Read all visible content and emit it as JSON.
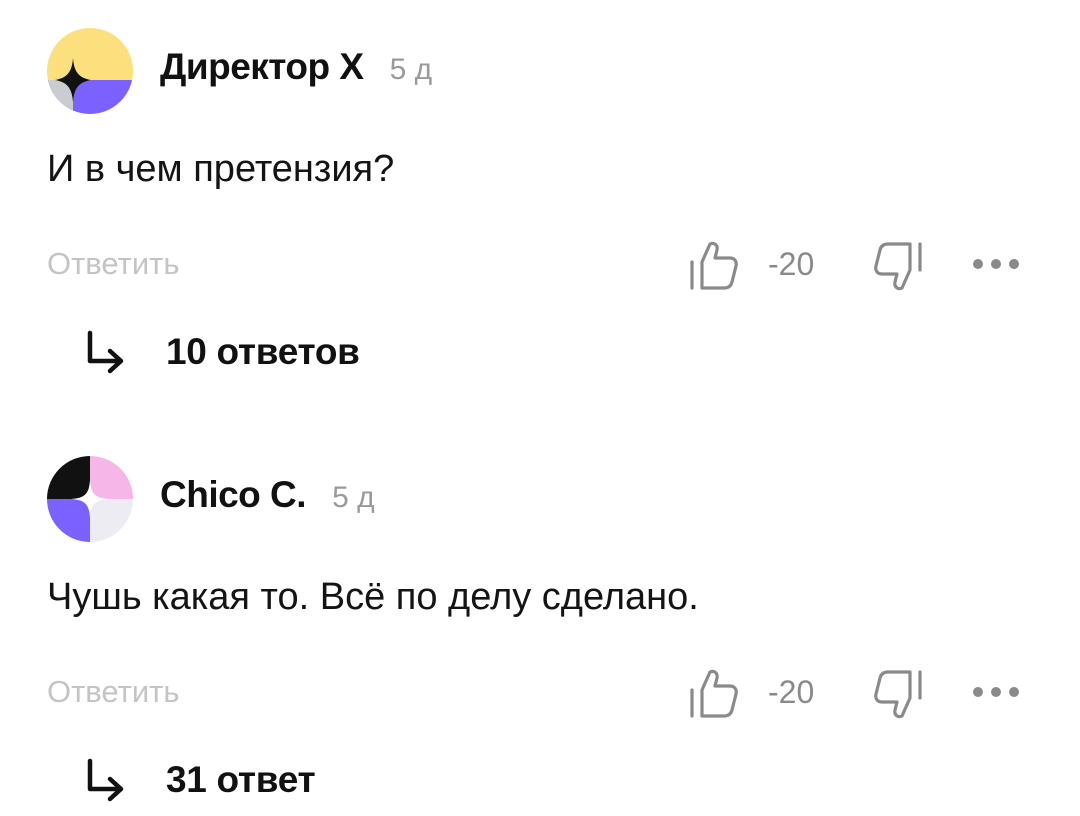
{
  "comments": [
    {
      "author": "Директор Х",
      "time": "5 д",
      "text": "И в чем претензия?",
      "reply_label": "Ответить",
      "score": "-20",
      "replies_label": "10 ответов",
      "avatar_colors": {
        "top": "#fbe07d",
        "bottom": "#7b61ff",
        "star": "#111111",
        "corner": "#c9ccd1"
      }
    },
    {
      "author": "Chico C.",
      "time": "5 д",
      "text": "Чушь какая то. Всё по делу сделано.",
      "reply_label": "Ответить",
      "score": "-20",
      "replies_label": "31 ответ",
      "avatar_colors": {
        "tl": "#111111",
        "tr": "#f7b6e8",
        "bl": "#7b61ff",
        "br": "#ececf2",
        "star": "#ffffff"
      }
    }
  ],
  "icons": {
    "like": "thumbs-up-icon",
    "dislike": "thumbs-down-icon",
    "more": "more-dots-icon",
    "replies": "reply-arrow-icon"
  },
  "colors": {
    "muted_text": "#9a9a9a",
    "reply_text": "#c4c4c4",
    "icon_gray": "#8a8a8a"
  }
}
